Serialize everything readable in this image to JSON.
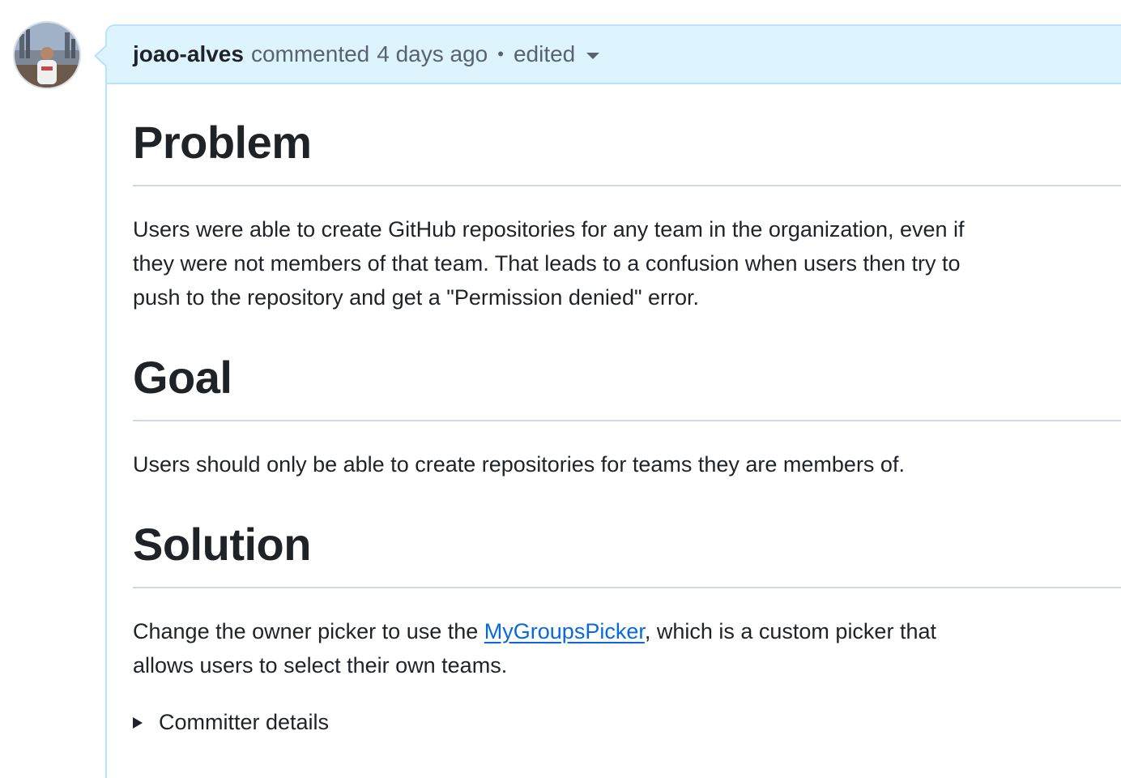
{
  "comment": {
    "author": "joao-alves",
    "action": "commented",
    "time": "4 days ago",
    "separator": "•",
    "edited_label": "edited"
  },
  "sections": {
    "problem": {
      "heading": "Problem",
      "text": "Users were able to create GitHub repositories for any team in the organization, even if they were not members of that team. That leads to a confusion when users then try to push to the repository and get a \"Permission denied\" error."
    },
    "goal": {
      "heading": "Goal",
      "text": "Users should only be able to create repositories for teams they are members of."
    },
    "solution": {
      "heading": "Solution",
      "text_before_link": "Change the owner picker to use the ",
      "link_text": "MyGroupsPicker",
      "text_after_link": ", which is a custom picker that allows users to select their own teams."
    }
  },
  "details": {
    "summary": "Committer details"
  },
  "colors": {
    "header_bg": "#ddf4ff",
    "header_border": "#b6e3ff",
    "link": "#0969da",
    "text": "#1f2328",
    "muted": "#59636e"
  }
}
